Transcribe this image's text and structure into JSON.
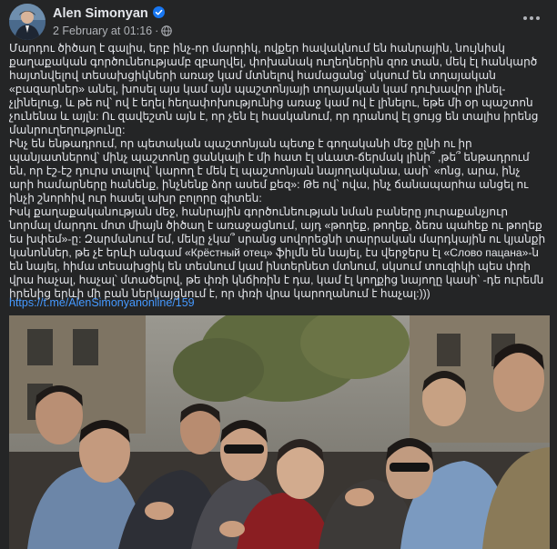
{
  "post": {
    "author": "Alen Simonyan",
    "date": "2 February at 01:16",
    "separator": "·",
    "icons": {
      "verified": "verified-badge-icon",
      "audience": "globe-icon",
      "menu": "more-options-icon"
    },
    "body": "Մարդու ծիծաղ է գալիս, երբ ինչ-որ մարդիկ, ովքեր հավակնում են հանրային, նույնիսկ քաղաքական գործունեությամբ զբաղվել, փոխանակ ուղեղներին զոռ տան, մեկ էլ հանկարծ հայտնվելով տեսախցիկների առաջ կամ մտնելով համացանց՝ սկսում են տղայական «բազարներ» անել, խոսել այս կամ այն պաշտոնյայի տղայական կամ դուխավոր լինել-չլինելուց, և թե ով՝ ով է եղել հեղափոխությունից առաջ կամ ով է լինելու, եթե մի օր պաշտոն չունենա և այլն: Ու զավեշտն այն է, որ չեն էլ հասկանում, որ դրանով էլ ցույց են տալիս իրենց մանրուղեղությունը:\nԻնչ են ենթադրում, որ պետական պաշտոնյան պետք է գողականի մեջ ըլնի ու իր պանյատներով՝ մինչ պաշտոնը ցանկալի է մի հատ էլ սևատ-ճերմակ լինի՞ ,թե՞ ենթադրում են, որ էշ-էշ դուրս տալով՝ կարող է մեկ էլ պաշտոնյան նայողականա, ասի՝ «ոնց, արա, ինչ արի համարները հանենք, ինչնենք ձոր ասեմ քեզ»: Թե ով՝ ովա, ինչ ճանապարհա անցել ու ինչի շնորհիվ ուր հասել ախր բոլորը գիտեն:\nԻսկ քաղաքականության մեջ, հանրային գործունեության նման բաները յուրաքանչյուր նորմալ մարդու մոտ միայն ծիծաղ է առաջացնում, այդ «թողեք, թողեք, ձեռս պահեք ու թողեք ես խփեմ»-ը: Զարմանում եմ, մեկը չկա՞ սրանց սովորեցնի տարրական մարդկային ու կյանքի կանոններ, թե չէ երևի անգամ «Крёстный отец» ֆիլմն են նայել, էս վերջերս էլ «Слово пацана»-ն են նայել, հիմա տեսախցիկ են տեսնում կամ ինտերնետ մտնում, սկսում տուզիկի պես փռի վրա հաչալ, հաչալ՝ մտածելով, թե փռի կնճիռին է դա, կամ էլ կողքից նայողը կասի՝ -դե ուրեմն իրենից երևի մի բան ներկայցնում է, որ փռի վրա կարողանում է հաչալ:)))",
    "link": "https://t.me/AlenSimonyanonline/159"
  }
}
